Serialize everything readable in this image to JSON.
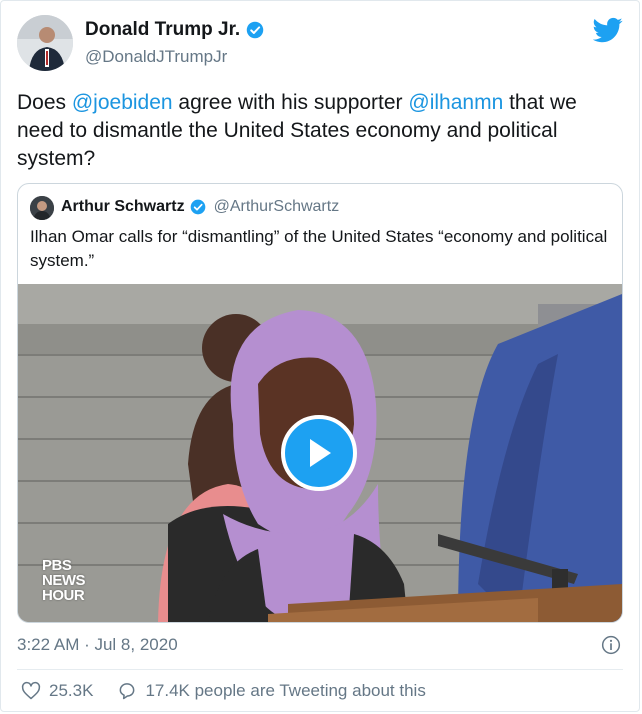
{
  "author": {
    "name": "Donald Trump Jr.",
    "handle": "@DonaldJTrumpJr"
  },
  "tweet": {
    "part1": "Does ",
    "mention1": "@joebiden",
    "part2": " agree with his supporter ",
    "mention2": "@ilhanmn",
    "part3": " that we need to dismantle the United States economy and political system?"
  },
  "quoted": {
    "name": "Arthur Schwartz",
    "handle": "@ArthurSchwartz",
    "text": "Ilhan Omar calls for “dismantling” of the United States “economy and political system.”",
    "video_watermark_line1": "PBS",
    "video_watermark_line2": "NEWS",
    "video_watermark_line3": "HOUR"
  },
  "meta": {
    "timestamp": "3:22 AM · Jul 8, 2020"
  },
  "actions": {
    "likes": "25.3K",
    "retweet_text": "17.4K people are Tweeting about this"
  },
  "icons": {
    "verified": "verified-badge-icon",
    "logo": "twitter-bird-icon",
    "play": "play-icon",
    "info": "info-icon",
    "like": "heart-icon",
    "reply": "speech-bubble-icon"
  },
  "colors": {
    "accent": "#1da1f2",
    "mention": "#1b95e0",
    "secondary_text": "#657786"
  }
}
